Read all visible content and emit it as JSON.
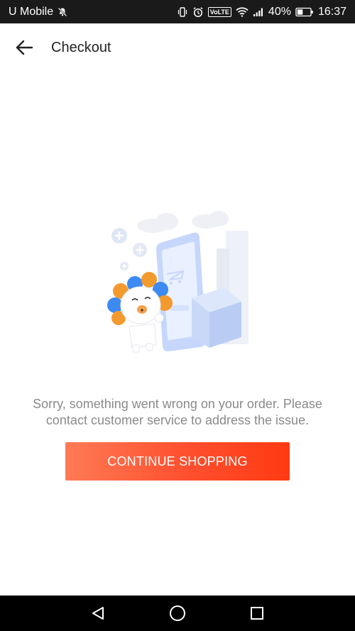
{
  "status_bar": {
    "carrier": "U Mobile",
    "volte": "VoLTE",
    "battery": "40%",
    "time": "16:37"
  },
  "header": {
    "title": "Checkout"
  },
  "main": {
    "message": "Sorry, something went wrong on your order. Please contact customer service to address the issue.",
    "cta_label": "CONTINUE SHOPPING"
  },
  "colors": {
    "cta_start": "#ff7a55",
    "cta_end": "#ff3a12",
    "status_bar_bg": "#1a1a1a",
    "nav_bar_bg": "#000000",
    "message_text": "#8a8a8a"
  },
  "icons": {
    "back": "arrow-left",
    "nav_back": "triangle-left",
    "nav_home": "circle",
    "nav_recents": "square"
  }
}
